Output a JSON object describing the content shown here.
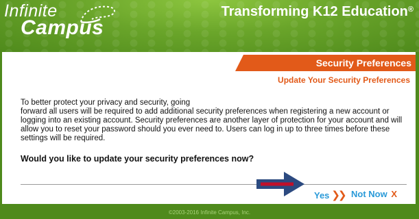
{
  "header": {
    "logo_top": "Infinite",
    "logo_bottom": "Campus",
    "tagline": "Transforming K12 Education",
    "tagline_mark": "®"
  },
  "panel": {
    "title": "Security Preferences",
    "subtitle": "Update Your Security Preferences",
    "body_line1": "To better protect your privacy and security, going",
    "body_line2": "forward all users will be required to add additional security preferences when registering a new account or logging into an existing account. Security preferences are another layer of protection for your account and will allow you to reset your password should you ever need to. Users can log in up to three times before these settings will be required.",
    "question": "Would you like to update your security preferences now?",
    "yes_label": "Yes",
    "yes_glyph": "❯❯",
    "not_now_label": "Not Now",
    "not_now_glyph": "X"
  },
  "footer": {
    "copyright": "©2003-2016 Infinite Campus, Inc."
  },
  "colors": {
    "green": "#6aa52a",
    "orange": "#e25a19",
    "link_blue": "#2a9ad8",
    "arrow_navy": "#2c4a80",
    "arrow_red": "#c0102a"
  },
  "icons": {
    "logo_swoosh": "infinity-swoosh-icon",
    "annotation_arrow": "right-arrow-icon"
  }
}
